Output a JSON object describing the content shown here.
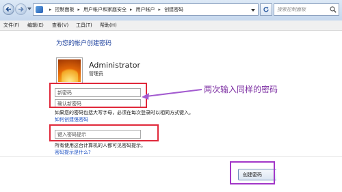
{
  "address": {
    "crumbs": [
      "控制面板",
      "用户帐户和家庭安全",
      "用户帐户",
      "创建密码"
    ],
    "separator": "▸"
  },
  "search": {
    "placeholder": "搜索控制面板"
  },
  "menu": [
    "文件(F)",
    "编辑(E)",
    "查看(V)",
    "工具(T)",
    "帮助(H)"
  ],
  "page": {
    "heading": "为您的帐户创建密码",
    "user_name": "Administrator",
    "user_role": "管理员",
    "new_password_placeholder": "新密码",
    "confirm_password_placeholder": "确认新密码",
    "caps_note": "如果您的密码包括大写字母，必须在每次登录时以相同方式键入。",
    "link_how_to_create": "如何创建强密码",
    "hint_placeholder": "键入密码提示",
    "hint_note": "所有使用这台计算机的人都可见密码提示。",
    "link_what_is_hint": "密码提示是什么?",
    "create_button": "创建密码"
  },
  "annotation": {
    "text": "两次输入同样的密码"
  },
  "colors": {
    "highlight_red": "#e0283a",
    "highlight_purple": "#a236c8",
    "annotation_text": "#7a2aa0",
    "link": "#1a4fc3",
    "heading": "#1a3e9c"
  },
  "icons": {
    "back": "back-arrow-icon",
    "forward": "forward-arrow-icon",
    "control_panel": "control-panel-icon",
    "refresh": "refresh-icon",
    "search": "search-icon",
    "avatar": "user-avatar-icon"
  }
}
